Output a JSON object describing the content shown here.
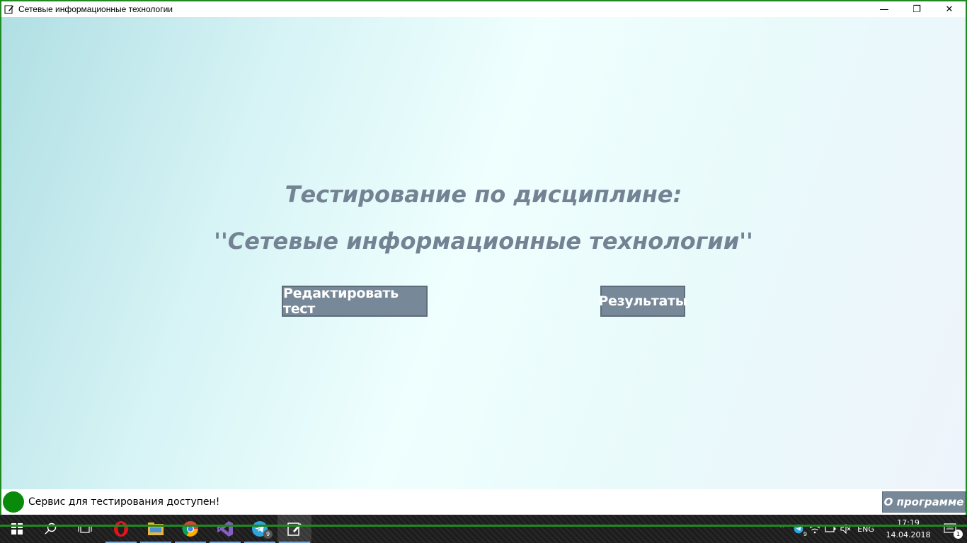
{
  "window": {
    "title": "Сетевые информационные технологии",
    "controls": {
      "minimize": "—",
      "restore": "❐",
      "close": "✕"
    }
  },
  "main": {
    "heading_line1": "Тестирование по дисциплине:",
    "heading_line2": "''Сетевые информационные технологии''",
    "edit_button": "Редактировать тест",
    "results_button": "Результаты"
  },
  "statusbar": {
    "status_text": "Сервис для тестирования доступен!",
    "status_color": "#0a8a0a",
    "about_button": "О программе"
  },
  "taskbar": {
    "apps": [
      {
        "name": "start",
        "icon": "windows-logo-icon"
      },
      {
        "name": "search",
        "icon": "search-icon"
      },
      {
        "name": "task-view",
        "icon": "task-view-icon"
      },
      {
        "name": "opera",
        "icon": "opera-icon"
      },
      {
        "name": "file-explorer",
        "icon": "folder-icon"
      },
      {
        "name": "chrome",
        "icon": "chrome-icon"
      },
      {
        "name": "visual-studio",
        "icon": "visual-studio-icon"
      },
      {
        "name": "telegram",
        "icon": "telegram-icon",
        "badge": "9"
      },
      {
        "name": "notepad-app",
        "icon": "edit-app-icon"
      }
    ],
    "tray": {
      "language": "ENG",
      "telegram_badge": "9",
      "time": "17:19",
      "date": "14.04.2018",
      "notifications_badge": "1"
    }
  },
  "colors": {
    "accent_green": "#1f8a1f",
    "button_bg": "#778899",
    "heading_color": "#748394"
  }
}
